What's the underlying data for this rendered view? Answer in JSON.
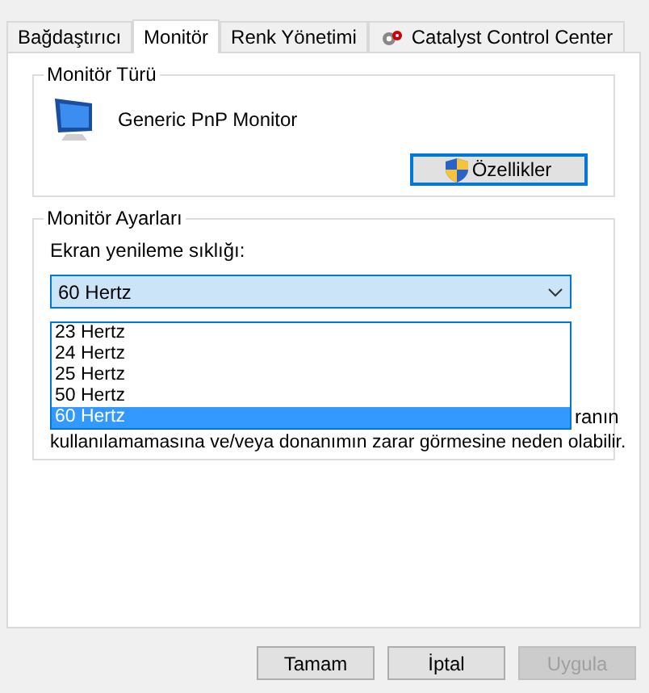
{
  "tabs": [
    {
      "label": "Bağdaştırıcı",
      "selected": false,
      "icon": false
    },
    {
      "label": "Monitör",
      "selected": true,
      "icon": false
    },
    {
      "label": "Renk Yönetimi",
      "selected": false,
      "icon": false
    },
    {
      "label": "Catalyst Control Center",
      "selected": false,
      "icon": true
    }
  ],
  "monitor_type": {
    "title": "Monitör Türü",
    "name": "Generic PnP Monitor",
    "properties_button": "Özellikler"
  },
  "monitor_settings": {
    "title": "Monitör Ayarları",
    "refresh_label": "Ekran yenileme sıklığı:",
    "refresh_value": "60 Hertz",
    "options": [
      {
        "label": "23 Hertz",
        "selected": false
      },
      {
        "label": "24 Hertz",
        "selected": false
      },
      {
        "label": "25 Hertz",
        "selected": false
      },
      {
        "label": "50 Hertz",
        "selected": false
      },
      {
        "label": "60 Hertz",
        "selected": true
      }
    ],
    "warning_fragment": "ranın",
    "warning_line": "kullanılamamasına ve/veya donanımın zarar görmesine neden olabilir."
  },
  "buttons": [
    {
      "label": "Tamam",
      "disabled": false
    },
    {
      "label": "İptal",
      "disabled": false
    },
    {
      "label": "Uygula",
      "disabled": true
    }
  ]
}
